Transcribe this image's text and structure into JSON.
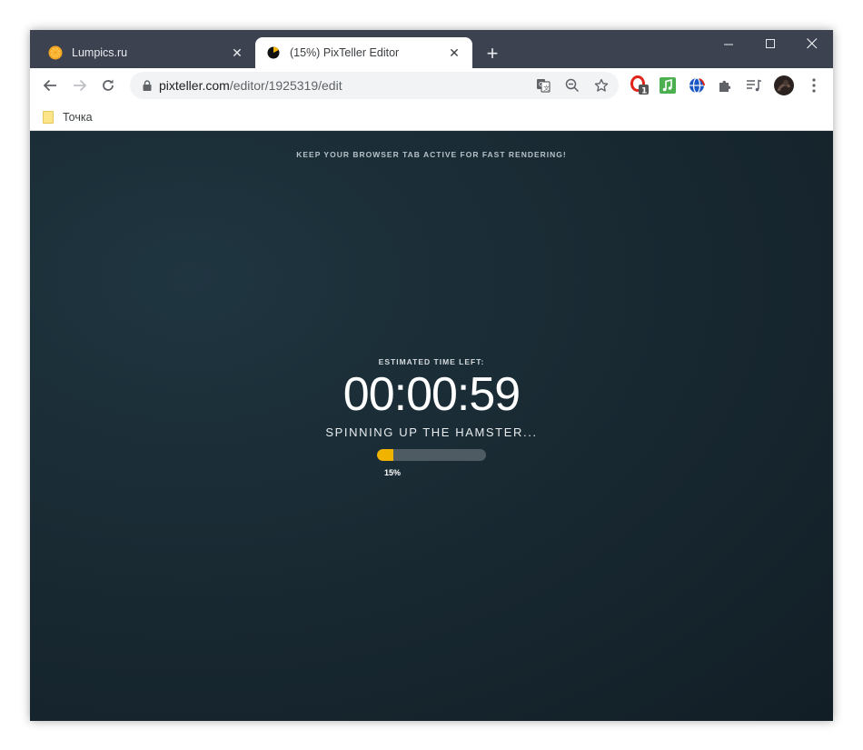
{
  "tabs": [
    {
      "title": "Lumpics.ru",
      "favicon": "orange-slice-icon",
      "active": false
    },
    {
      "title": "(15%) PixTeller Editor",
      "favicon": "progress-pie-icon",
      "active": true
    }
  ],
  "address": {
    "domain": "pixteller.com",
    "path": "/editor/1925319/edit"
  },
  "extensions": {
    "opera_badge": "1"
  },
  "bookmarks": [
    {
      "label": "Точка",
      "icon": "folder-icon"
    }
  ],
  "page": {
    "notice": "KEEP YOUR BROWSER TAB ACTIVE FOR FAST RENDERING!",
    "eta_label": "ESTIMATED TIME LEFT:",
    "timer": "00:00:59",
    "status": "SPINNING UP THE HAMSTER...",
    "progress": 0.15,
    "progress_label": "15%"
  },
  "colors": {
    "titlebar": "#3c4250",
    "background": "#192a33",
    "progress_fill": "#f0b400",
    "progress_track": "#4f5b62"
  }
}
